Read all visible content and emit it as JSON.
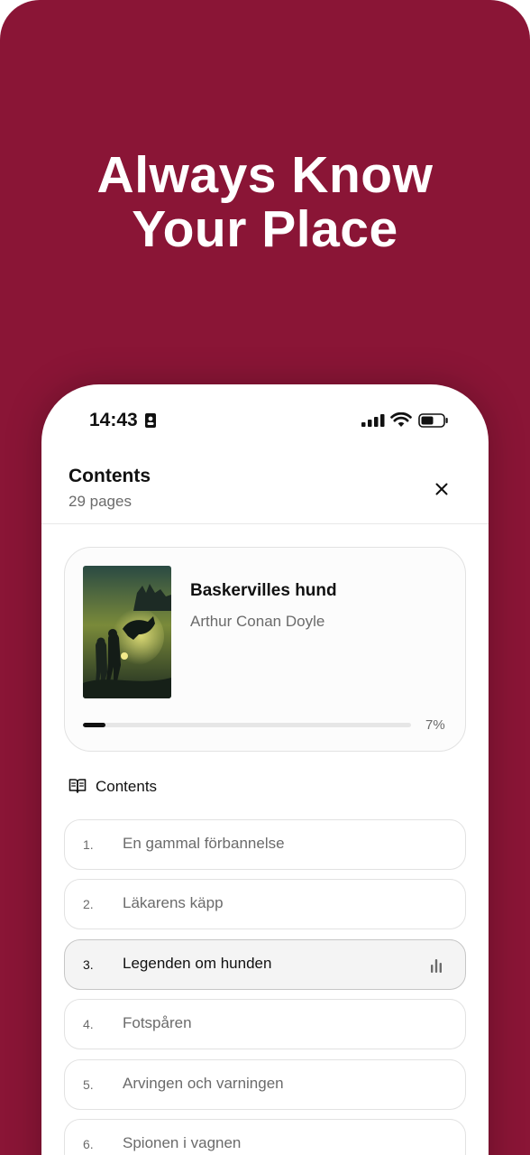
{
  "promo": {
    "headline_line1": "Always Know",
    "headline_line2": "Your Place",
    "background_color": "#8a1536"
  },
  "status_bar": {
    "time": "14:43",
    "icons": [
      "sim-card-icon",
      "cellular-signal-icon",
      "wifi-icon",
      "battery-icon"
    ]
  },
  "header": {
    "title": "Contents",
    "subtitle": "29 pages",
    "close_icon": "close-icon"
  },
  "book": {
    "title": "Baskervilles hund",
    "author": "Arthur Conan Doyle",
    "progress_fraction": 0.07,
    "progress_label": "7%"
  },
  "contents": {
    "heading": "Contents",
    "icon": "open-book-icon",
    "chapters": [
      {
        "number": "1.",
        "title": "En gammal förbannelse",
        "active": false
      },
      {
        "number": "2.",
        "title": "Läkarens käpp",
        "active": false
      },
      {
        "number": "3.",
        "title": "Legenden om hunden",
        "active": true,
        "indicator_icon": "bar-chart-icon"
      },
      {
        "number": "4.",
        "title": "Fotspåren",
        "active": false
      },
      {
        "number": "5.",
        "title": "Arvingen och varningen",
        "active": false
      },
      {
        "number": "6.",
        "title": "Spionen i vagnen",
        "active": false
      }
    ]
  }
}
